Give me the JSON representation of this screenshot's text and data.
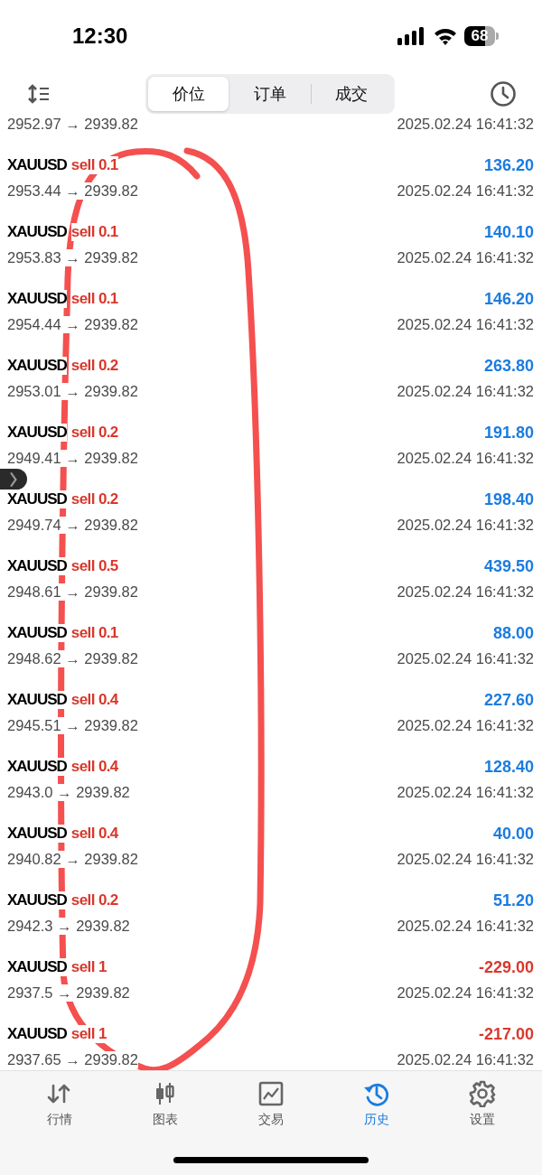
{
  "status_bar": {
    "time": "12:30",
    "battery": "68"
  },
  "segments": [
    {
      "label": "价位",
      "selected": true
    },
    {
      "label": "订单",
      "selected": false
    },
    {
      "label": "成交",
      "selected": false
    }
  ],
  "trades": [
    {
      "prices": "2952.97 → 2939.82",
      "time": "2025.02.24 16:41:32"
    },
    {
      "symbol": "XAUUSD",
      "order": "sell 0.1",
      "profit": "136.20",
      "loss": false,
      "prices": "2953.44 → 2939.82",
      "time": "2025.02.24 16:41:32"
    },
    {
      "symbol": "XAUUSD",
      "order": "sell 0.1",
      "profit": "140.10",
      "loss": false,
      "prices": "2953.83 → 2939.82",
      "time": "2025.02.24 16:41:32"
    },
    {
      "symbol": "XAUUSD",
      "order": "sell 0.1",
      "profit": "146.20",
      "loss": false,
      "prices": "2954.44 → 2939.82",
      "time": "2025.02.24 16:41:32"
    },
    {
      "symbol": "XAUUSD",
      "order": "sell 0.2",
      "profit": "263.80",
      "loss": false,
      "prices": "2953.01 → 2939.82",
      "time": "2025.02.24 16:41:32"
    },
    {
      "symbol": "XAUUSD",
      "order": "sell 0.2",
      "profit": "191.80",
      "loss": false,
      "prices": "2949.41 → 2939.82",
      "time": "2025.02.24 16:41:32"
    },
    {
      "symbol": "XAUUSD",
      "order": "sell 0.2",
      "profit": "198.40",
      "loss": false,
      "prices": "2949.74 → 2939.82",
      "time": "2025.02.24 16:41:32"
    },
    {
      "symbol": "XAUUSD",
      "order": "sell 0.5",
      "profit": "439.50",
      "loss": false,
      "prices": "2948.61 → 2939.82",
      "time": "2025.02.24 16:41:32"
    },
    {
      "symbol": "XAUUSD",
      "order": "sell 0.1",
      "profit": "88.00",
      "loss": false,
      "prices": "2948.62 → 2939.82",
      "time": "2025.02.24 16:41:32"
    },
    {
      "symbol": "XAUUSD",
      "order": "sell 0.4",
      "profit": "227.60",
      "loss": false,
      "prices": "2945.51 → 2939.82",
      "time": "2025.02.24 16:41:32"
    },
    {
      "symbol": "XAUUSD",
      "order": "sell 0.4",
      "profit": "128.40",
      "loss": false,
      "prices": "2943.0 → 2939.82",
      "time": "2025.02.24 16:41:32"
    },
    {
      "symbol": "XAUUSD",
      "order": "sell 0.4",
      "profit": "40.00",
      "loss": false,
      "prices": "2940.82 → 2939.82",
      "time": "2025.02.24 16:41:32"
    },
    {
      "symbol": "XAUUSD",
      "order": "sell 0.2",
      "profit": "51.20",
      "loss": false,
      "prices": "2942.3 → 2939.82",
      "time": "2025.02.24 16:41:32"
    },
    {
      "symbol": "XAUUSD",
      "order": "sell 1",
      "profit": "-229.00",
      "loss": true,
      "prices": "2937.5 → 2939.82",
      "time": "2025.02.24 16:41:32"
    },
    {
      "symbol": "XAUUSD",
      "order": "sell 1",
      "profit": "-217.00",
      "loss": true,
      "prices": "2937.65 → 2939.82",
      "time": "2025.02.24 16:41:32"
    }
  ],
  "tab_bar": [
    {
      "label": "行情",
      "kind": "quotes",
      "selected": false
    },
    {
      "label": "图表",
      "kind": "chart",
      "selected": false
    },
    {
      "label": "交易",
      "kind": "trade",
      "selected": false
    },
    {
      "label": "历史",
      "kind": "history",
      "selected": true
    },
    {
      "label": "设置",
      "kind": "settings",
      "selected": false
    }
  ]
}
